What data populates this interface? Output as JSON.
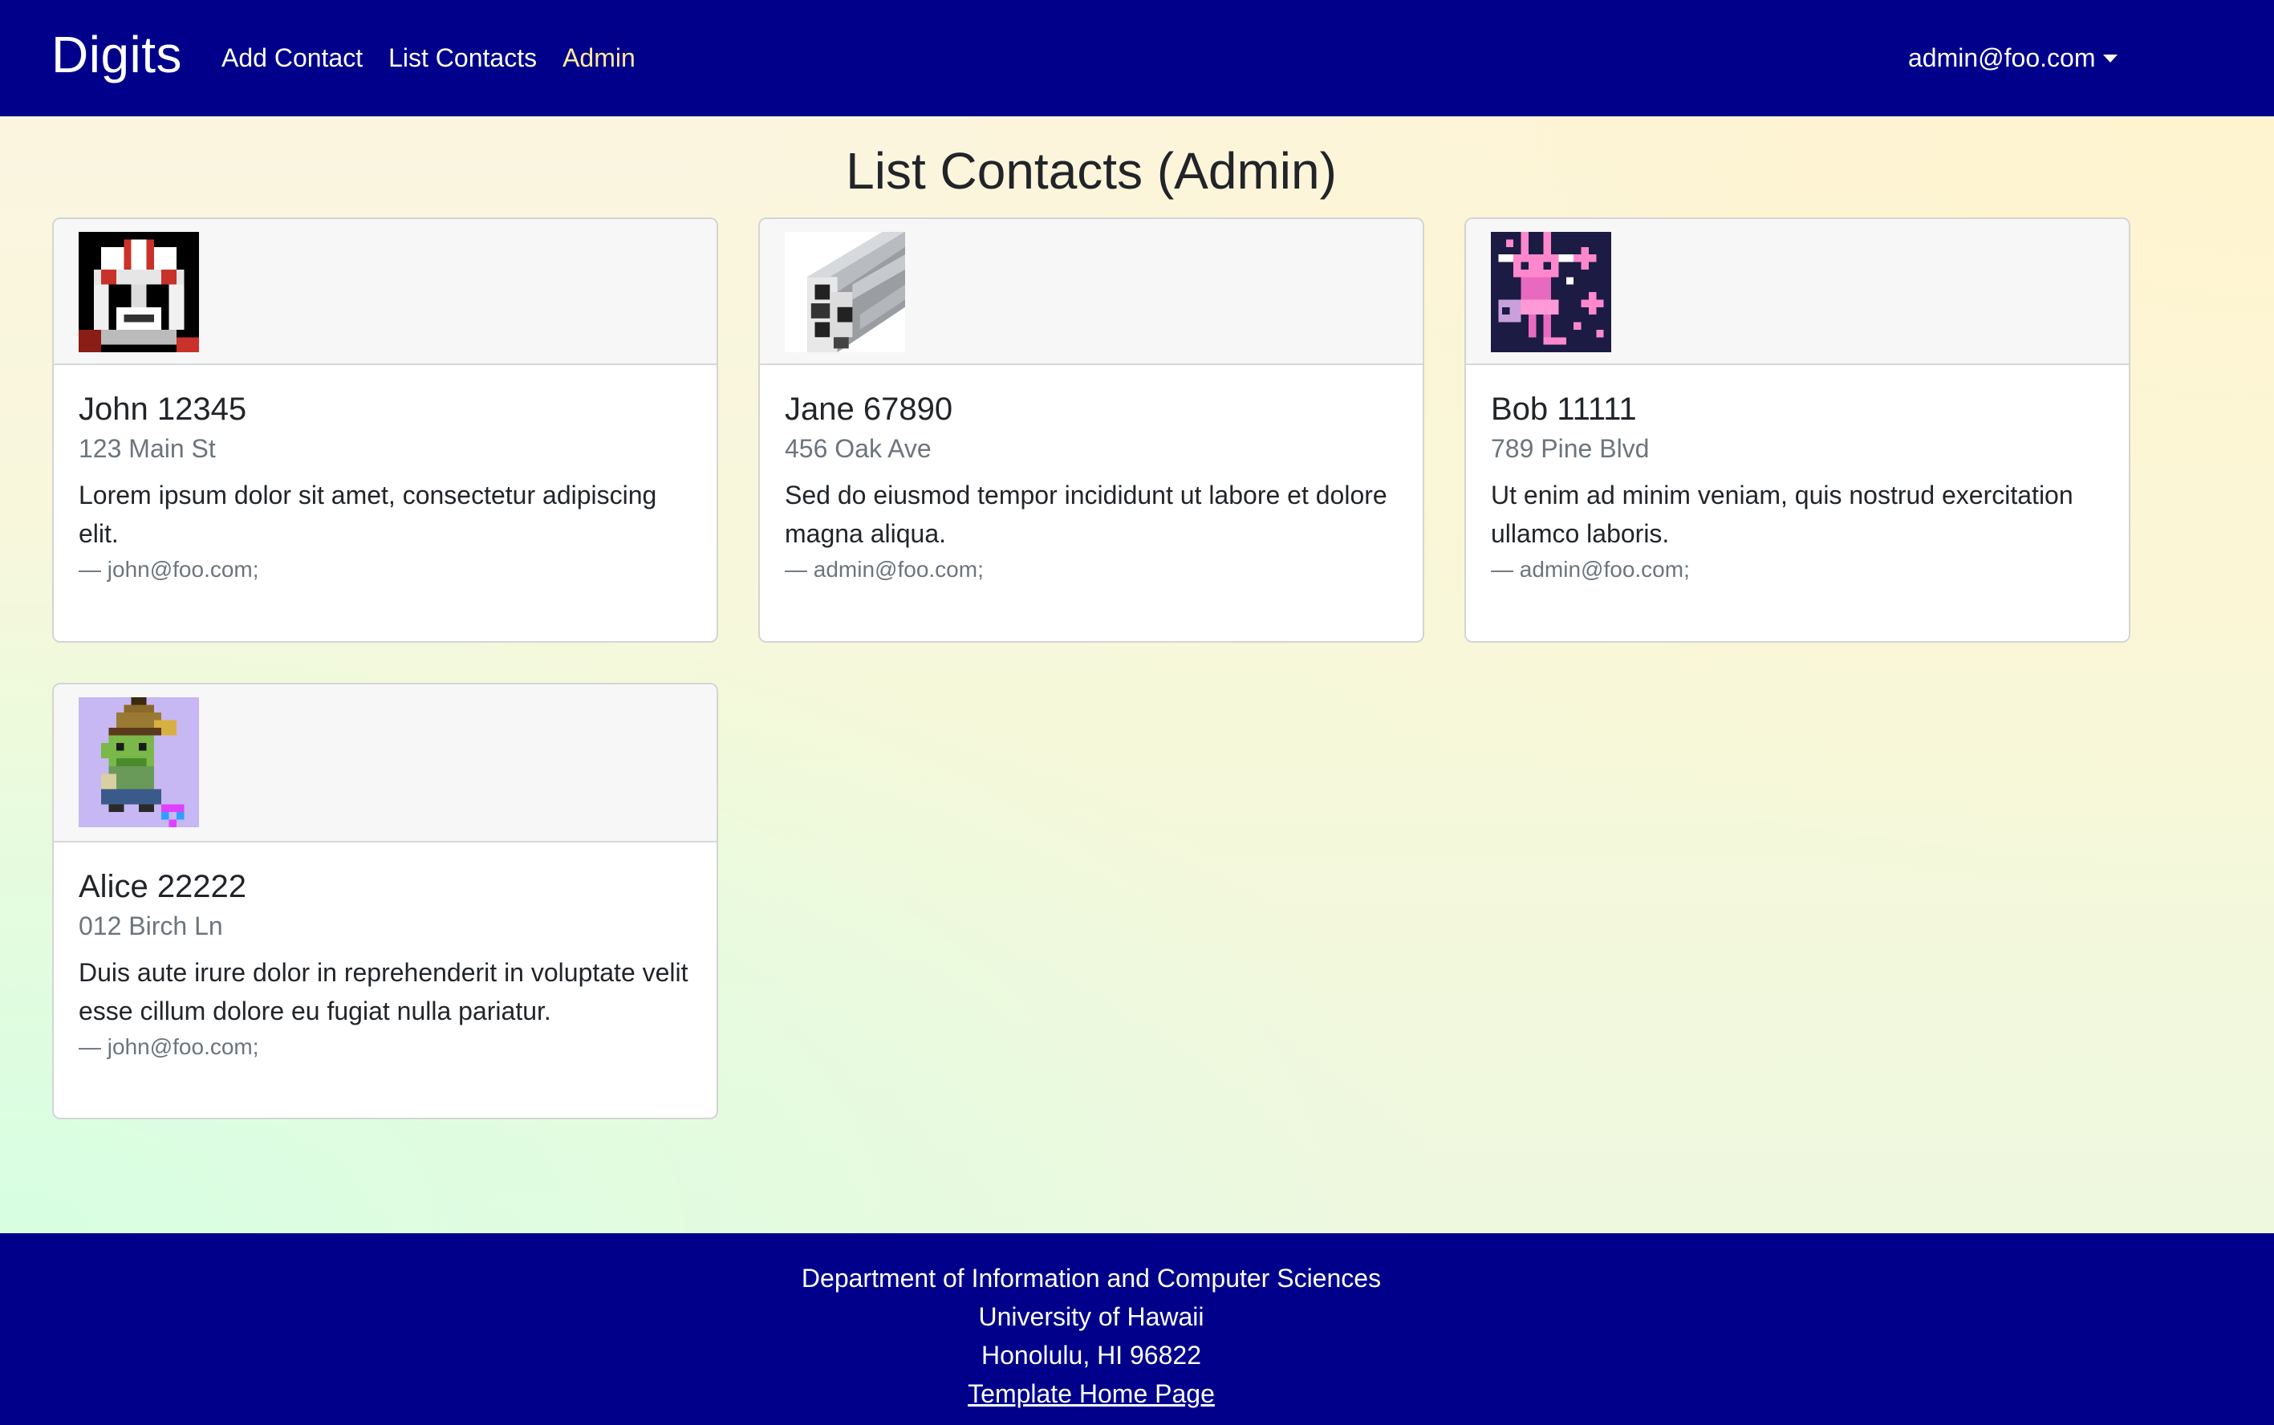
{
  "navbar": {
    "brand": "Digits",
    "links": [
      {
        "label": "Add Contact"
      },
      {
        "label": "List Contacts"
      },
      {
        "label": "Admin"
      }
    ],
    "user": "admin@foo.com",
    "background": "#00008b",
    "active_link_color": "#ffeb99"
  },
  "page": {
    "title": "List Contacts (Admin)"
  },
  "contacts": [
    {
      "name": "John 12345",
      "address": "123 Main St",
      "description": "Lorem ipsum dolor sit amet, consectetur adipiscing elit.",
      "owner": "— john@foo.com;",
      "avatar_icon": "pilot-helmet-avatar"
    },
    {
      "name": "Jane 67890",
      "address": "456 Oak Ave",
      "description": "Sed do eiusmod tempor incididunt ut labore et dolore magna aliqua.",
      "owner": "— admin@foo.com;",
      "avatar_icon": "aluminum-extrusion-avatar"
    },
    {
      "name": "Bob 11111",
      "address": "789 Pine Blvd",
      "description": "Ut enim ad minim veniam, quis nostrud exercitation ullamco laboris.",
      "owner": "— admin@foo.com;",
      "avatar_icon": "pink-bunny-avatar"
    },
    {
      "name": "Alice 22222",
      "address": "012 Birch Ln",
      "description": "Duis aute irure dolor in reprehenderit in voluptate velit esse cillum dolore eu fugiat nulla pariatur.",
      "owner": "— john@foo.com;",
      "avatar_icon": "pixel-elf-avatar"
    }
  ],
  "footer": {
    "line1": "Department of Information and Computer Sciences",
    "line2": "University of Hawaii",
    "line3": "Honolulu, HI 96822",
    "link": "Template Home Page"
  }
}
